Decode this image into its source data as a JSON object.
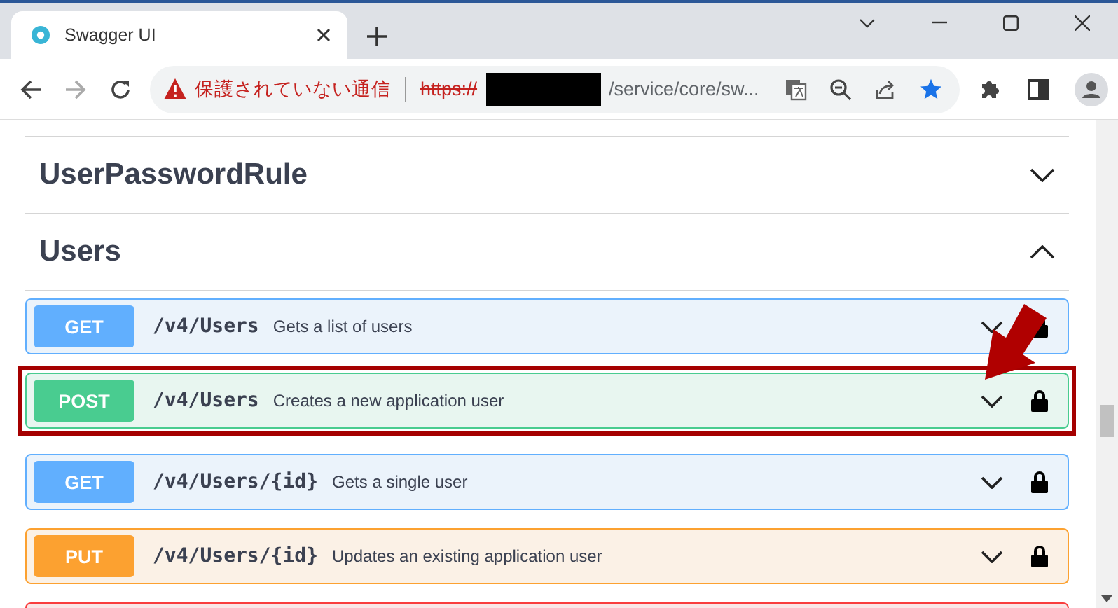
{
  "browser": {
    "tab_title": "Swagger UI",
    "security_warning": "保護されていない通信",
    "url_scheme": "https://",
    "url_path": "/service/core/sw..."
  },
  "sections": [
    {
      "title": "UserPasswordRule",
      "expanded": false
    },
    {
      "title": "Users",
      "expanded": true,
      "operations": [
        {
          "kind": "get",
          "method": "GET",
          "path": "/v4/Users",
          "summary": "Gets a list of users",
          "highlighted": false
        },
        {
          "kind": "post",
          "method": "POST",
          "path": "/v4/Users",
          "summary": "Creates a new application user",
          "highlighted": true
        },
        {
          "kind": "get",
          "method": "GET",
          "path": "/v4/Users/{id}",
          "summary": "Gets a single user",
          "highlighted": false
        },
        {
          "kind": "put",
          "method": "PUT",
          "path": "/v4/Users/{id}",
          "summary": "Updates an existing application user",
          "highlighted": false
        },
        {
          "kind": "delete",
          "highlighted": false
        }
      ]
    }
  ]
}
